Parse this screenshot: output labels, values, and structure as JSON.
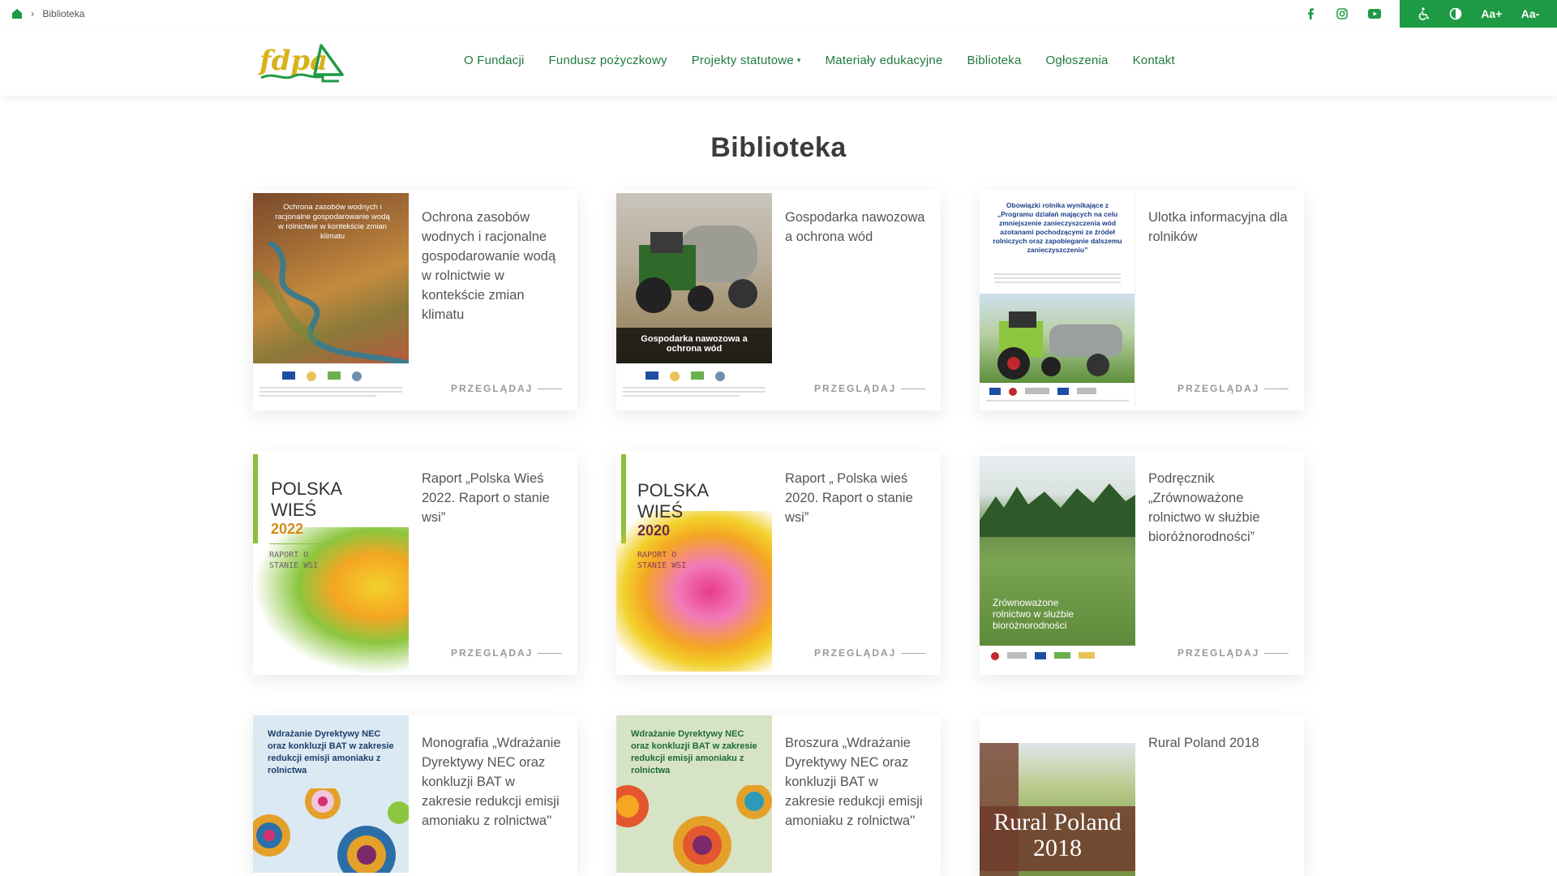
{
  "breadcrumb": {
    "current": "Biblioteka"
  },
  "accessibility": {
    "font_increase": "Aa+",
    "font_decrease": "Aa-"
  },
  "nav": {
    "items": [
      "O Fundacji",
      "Fundusz pożyczkowy",
      "Projekty statutowe",
      "Materiały edukacyjne",
      "Biblioteka",
      "Ogłoszenia",
      "Kontakt"
    ],
    "dropdown_caret": "▾"
  },
  "logo": {
    "text": "fdpa"
  },
  "page": {
    "title": "Biblioteka"
  },
  "cards": [
    {
      "title": "Ochrona zasobów wodnych i racjonalne gospodarowanie wodą w rolnictwie w kontekście zmian klimatu",
      "link": "PRZEGLĄDAJ",
      "cover_text": "Ochrona zasobów wodnych i racjonalne gospodarowanie wodą w rolnictwie w kontekście zmian klimatu"
    },
    {
      "title": "Gospodarka nawozowa a ochrona wód",
      "link": "PRZEGLĄDAJ",
      "cover_text": "Gospodarka nawozowa a ochrona wód"
    },
    {
      "title": "Ulotka informacyjna dla rolników",
      "link": "PRZEGLĄDAJ",
      "cover_text": "Obowiązki rolnika wynikające z „Programu działań mających na celu zmniejszenie zanieczyszczenia wód azotanami pochodzącymi ze źródeł rolniczych oraz zapobieganie dalszemu zanieczyszczeniu”"
    },
    {
      "title": "Raport „Polska Wieś 2022. Raport o stanie wsi”",
      "link": "PRZEGLĄDAJ",
      "cover_line1": "POLSKA",
      "cover_line2": "WIEŚ",
      "cover_year": "2022",
      "cover_sub": "RAPORT O STANIE WSI"
    },
    {
      "title": "Raport „ Polska wieś 2020. Raport o stanie wsi”",
      "link": "PRZEGLĄDAJ",
      "cover_line1": "POLSKA",
      "cover_line2": "WIEŚ",
      "cover_year": "2020",
      "cover_sub": "RAPORT O STANIE WSI"
    },
    {
      "title": "Podręcznik „Zrównoważone rolnictwo w służbie bioróżnorodności”",
      "link": "PRZEGLĄDAJ",
      "cover_text": "Zrównoważone rolnictwo w służbie bioróżnorodności"
    },
    {
      "title": "Monografia „Wdrażanie Dyrektywy NEC oraz konkluzji BAT w zakresie redukcji emisji amoniaku z rolnictwa''",
      "cover_text": "Wdrażanie Dyrektywy NEC oraz konkluzji BAT w zakresie redukcji emisji amoniaku z rolnictwa"
    },
    {
      "title": "Broszura „Wdrażanie Dyrektywy NEC oraz konkluzji BAT w zakresie redukcji emisji amoniaku z rolnictwa''",
      "cover_text": "Wdrażanie Dyrektywy NEC oraz konkluzji BAT w zakresie redukcji emisji amoniaku z rolnictwa"
    },
    {
      "title": "Rural Poland 2018",
      "cover_line1": "Rural Poland",
      "cover_year": "2018"
    }
  ],
  "colors": {
    "brand_green": "#1e9a45",
    "nav_green": "#1f7a3e",
    "logo_yellow": "#d8b21d"
  }
}
